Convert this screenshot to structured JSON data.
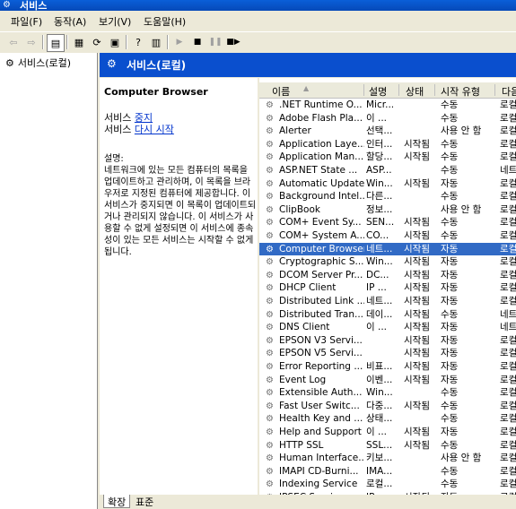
{
  "window": {
    "title": "서비스"
  },
  "menu": [
    "파일(F)",
    "동작(A)",
    "보기(V)",
    "도움말(H)"
  ],
  "tree": {
    "root": "서비스(로컬)"
  },
  "header": {
    "title": "서비스(로컬)"
  },
  "detail": {
    "service_name": "Computer Browser",
    "stop_prefix": "서비스 ",
    "stop_link": "중지",
    "restart_prefix": "서비스 ",
    "restart_link": "다시 시작",
    "description_label": "설명:",
    "description": "네트워크에 있는 모든 컴퓨터의 목록을 업데이트하고 관리하며, 이 목록을 브라우저로 지정된 컴퓨터에 제공합니다. 이 서비스가 중지되면 이 목록이 업데이트되거나 관리되지 않습니다. 이 서비스가 사용할 수 없게 설정되면 이 서비스에 종속성이 있는 모든 서비스는 시작할 수 없게 됩니다."
  },
  "columns": [
    "이름",
    "설명",
    "상태",
    "시작 유형",
    "다음"
  ],
  "services": [
    {
      "name": ".NET Runtime O...",
      "desc": "Micr...",
      "status": "",
      "startup": "수동",
      "logon": "로컬"
    },
    {
      "name": "Adobe Flash Pla...",
      "desc": "이 ...",
      "status": "",
      "startup": "수동",
      "logon": "로컬"
    },
    {
      "name": "Alerter",
      "desc": "선택...",
      "status": "",
      "startup": "사용 안 함",
      "logon": "로컬"
    },
    {
      "name": "Application Laye...",
      "desc": "인터...",
      "status": "시작됨",
      "startup": "수동",
      "logon": "로컬"
    },
    {
      "name": "Application Man...",
      "desc": "할당...",
      "status": "시작됨",
      "startup": "수동",
      "logon": "로컬"
    },
    {
      "name": "ASP.NET State ...",
      "desc": "ASP...",
      "status": "",
      "startup": "수동",
      "logon": "네트"
    },
    {
      "name": "Automatic Updates",
      "desc": "Win...",
      "status": "시작됨",
      "startup": "자동",
      "logon": "로컬"
    },
    {
      "name": "Background Intel...",
      "desc": "다른...",
      "status": "",
      "startup": "수동",
      "logon": "로컬"
    },
    {
      "name": "ClipBook",
      "desc": "정보...",
      "status": "",
      "startup": "사용 안 함",
      "logon": "로컬"
    },
    {
      "name": "COM+ Event Sy...",
      "desc": "SEN...",
      "status": "시작됨",
      "startup": "수동",
      "logon": "로컬"
    },
    {
      "name": "COM+ System A...",
      "desc": "CO...",
      "status": "시작됨",
      "startup": "수동",
      "logon": "로컬"
    },
    {
      "name": "Computer Browser",
      "desc": "네트...",
      "status": "시작됨",
      "startup": "자동",
      "logon": "로컬",
      "selected": true
    },
    {
      "name": "Cryptographic S...",
      "desc": "Win...",
      "status": "시작됨",
      "startup": "자동",
      "logon": "로컬"
    },
    {
      "name": "DCOM Server Pr...",
      "desc": "DC...",
      "status": "시작됨",
      "startup": "자동",
      "logon": "로컬"
    },
    {
      "name": "DHCP Client",
      "desc": "IP ...",
      "status": "시작됨",
      "startup": "자동",
      "logon": "로컬"
    },
    {
      "name": "Distributed Link ...",
      "desc": "네트...",
      "status": "시작됨",
      "startup": "자동",
      "logon": "로컬"
    },
    {
      "name": "Distributed Tran...",
      "desc": "데이...",
      "status": "시작됨",
      "startup": "수동",
      "logon": "네트"
    },
    {
      "name": "DNS Client",
      "desc": "이 ...",
      "status": "시작됨",
      "startup": "자동",
      "logon": "네트"
    },
    {
      "name": "EPSON V3 Servi...",
      "desc": "",
      "status": "시작됨",
      "startup": "자동",
      "logon": "로컬"
    },
    {
      "name": "EPSON V5 Servi...",
      "desc": "",
      "status": "시작됨",
      "startup": "자동",
      "logon": "로컬"
    },
    {
      "name": "Error Reporting ...",
      "desc": "비표...",
      "status": "시작됨",
      "startup": "자동",
      "logon": "로컬"
    },
    {
      "name": "Event Log",
      "desc": "이벤...",
      "status": "시작됨",
      "startup": "자동",
      "logon": "로컬"
    },
    {
      "name": "Extensible Auth...",
      "desc": "Win...",
      "status": "",
      "startup": "수동",
      "logon": "로컬"
    },
    {
      "name": "Fast User Switc...",
      "desc": "다중...",
      "status": "시작됨",
      "startup": "수동",
      "logon": "로컬"
    },
    {
      "name": "Health Key and ...",
      "desc": "상태...",
      "status": "",
      "startup": "수동",
      "logon": "로컬"
    },
    {
      "name": "Help and Support",
      "desc": "이 ...",
      "status": "시작됨",
      "startup": "자동",
      "logon": "로컬"
    },
    {
      "name": "HTTP SSL",
      "desc": "SSL...",
      "status": "시작됨",
      "startup": "수동",
      "logon": "로컬"
    },
    {
      "name": "Human Interface...",
      "desc": "키보...",
      "status": "",
      "startup": "사용 안 함",
      "logon": "로컬"
    },
    {
      "name": "IMAPI CD-Burni...",
      "desc": "IMA...",
      "status": "",
      "startup": "수동",
      "logon": "로컬"
    },
    {
      "name": "Indexing Service",
      "desc": "로컬...",
      "status": "",
      "startup": "수동",
      "logon": "로컬"
    },
    {
      "name": "IPSEC Services",
      "desc": "IP ...",
      "status": "시작됨",
      "startup": "자동",
      "logon": "로컬"
    }
  ],
  "tabs": [
    "확장",
    "표준"
  ]
}
